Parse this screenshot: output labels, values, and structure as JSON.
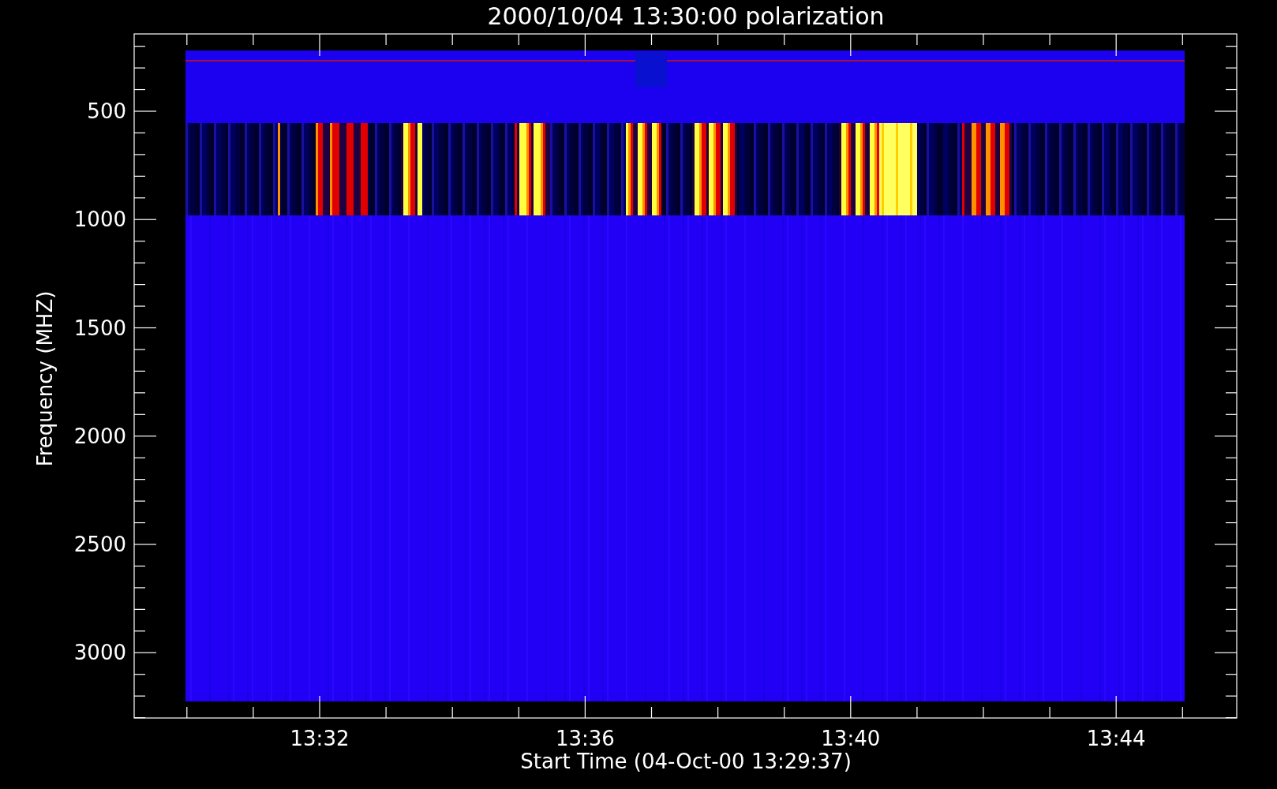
{
  "chart": {
    "title": "2000/10/04 13:30:00 polarization",
    "xlabel": "Start Time (04-Oct-00 13:29:37)",
    "ylabel": "Frequency (MHZ)",
    "y_ticks": [
      "500",
      "1000",
      "1500",
      "2000",
      "2500",
      "3000"
    ],
    "x_ticks": [
      "13:32",
      "13:36",
      "13:40",
      "13:44"
    ]
  }
}
